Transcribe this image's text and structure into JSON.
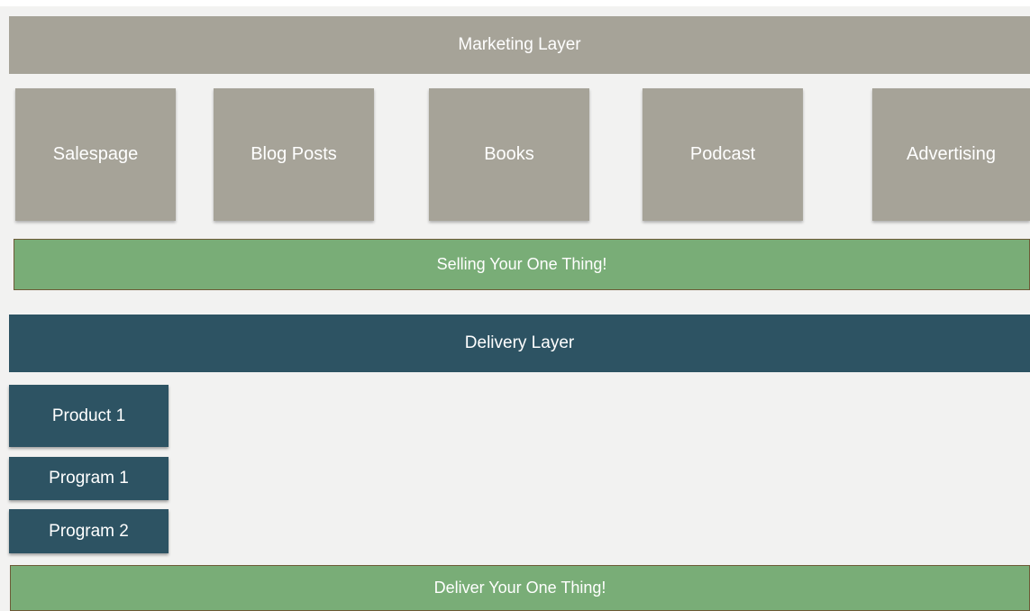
{
  "marketing": {
    "title": "Marketing Layer",
    "items": [
      "Salespage",
      "Blog Posts",
      "Books",
      "Podcast",
      "Advertising"
    ],
    "goal": "Selling Your One Thing!"
  },
  "delivery": {
    "title": "Delivery Layer",
    "items": [
      "Product 1",
      "Program 1",
      "Program 2"
    ],
    "goal": "Deliver Your One Thing!"
  },
  "colors": {
    "marketing": "#a6a398",
    "goal": "#79ad77",
    "delivery": "#2d5363",
    "background": "#f2f2f1"
  }
}
